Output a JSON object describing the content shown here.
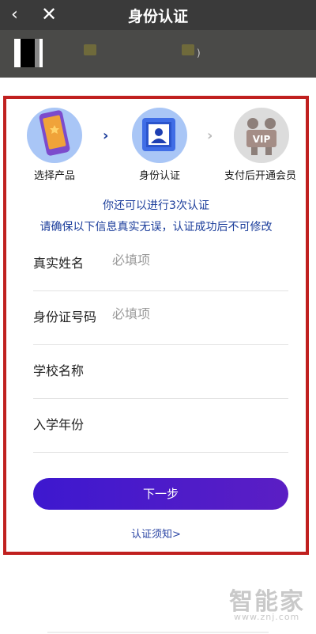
{
  "header": {
    "title": "身份认证",
    "back_icon": "‹",
    "close_icon": "✕"
  },
  "account": {
    "paren": ")"
  },
  "steps": [
    {
      "label": "选择产品"
    },
    {
      "label": "身份认证"
    },
    {
      "label": "支付后开通会员"
    }
  ],
  "info": {
    "attempts": "你还可以进行3次认证",
    "warning": "请确保以下信息真实无误，认证成功后不可修改"
  },
  "form": {
    "fields": [
      {
        "label": "真实姓名",
        "placeholder": "必填项"
      },
      {
        "label": "身份证号码",
        "placeholder": "必填项"
      },
      {
        "label": "学校名称",
        "placeholder": ""
      },
      {
        "label": "入学年份",
        "placeholder": ""
      }
    ]
  },
  "actions": {
    "next_label": "下一步",
    "notice_label": "认证须知>"
  },
  "watermark": {
    "brand": "智能家",
    "url": "www.znj.com"
  },
  "colors": {
    "accent": "#3d18cf",
    "link": "#1b3d9b",
    "frame": "#c0201f"
  }
}
